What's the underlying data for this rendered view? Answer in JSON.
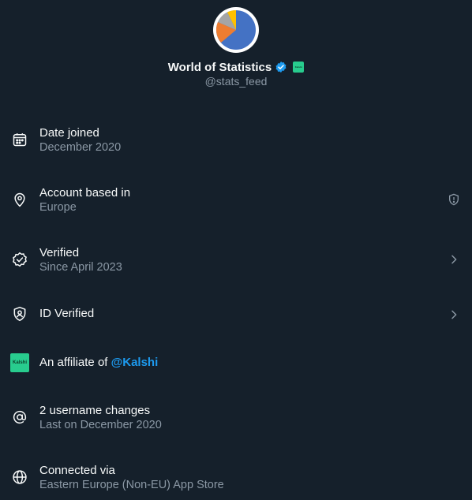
{
  "profile": {
    "display_name": "World of Statistics",
    "handle": "@stats_feed",
    "avatar_icon": "pie-chart-avatar",
    "verified_icon": "verified-badge-icon",
    "affiliate_logo_text": "Kalshi"
  },
  "rows": [
    {
      "icon": "calendar-icon",
      "title": "Date joined",
      "sub": "December 2020"
    },
    {
      "icon": "location-pin-icon",
      "title": "Account based in",
      "sub": "Europe",
      "right_icon": "shield-alert-icon"
    },
    {
      "icon": "verified-check-icon",
      "title": "Verified",
      "sub": "Since April 2023",
      "right_icon": "chevron-right-icon"
    },
    {
      "icon": "id-badge-icon",
      "title": "ID Verified",
      "right_icon": "chevron-right-icon"
    },
    {
      "icon": "kalshi-logo",
      "logo_text": "Kalshi",
      "title_prefix": "An affiliate of ",
      "mention": "@Kalshi"
    },
    {
      "icon": "at-sign-icon",
      "title": "2 username changes",
      "sub": "Last on December 2020"
    },
    {
      "icon": "globe-icon",
      "title": "Connected via",
      "sub": "Eastern Europe (Non-EU) App Store"
    }
  ],
  "colors": {
    "background": "#15202b",
    "primary_text": "#f7f9f9",
    "secondary_text": "#8b98a5",
    "accent": "#1d9bf0",
    "kalshi_green": "#28cc8e"
  }
}
